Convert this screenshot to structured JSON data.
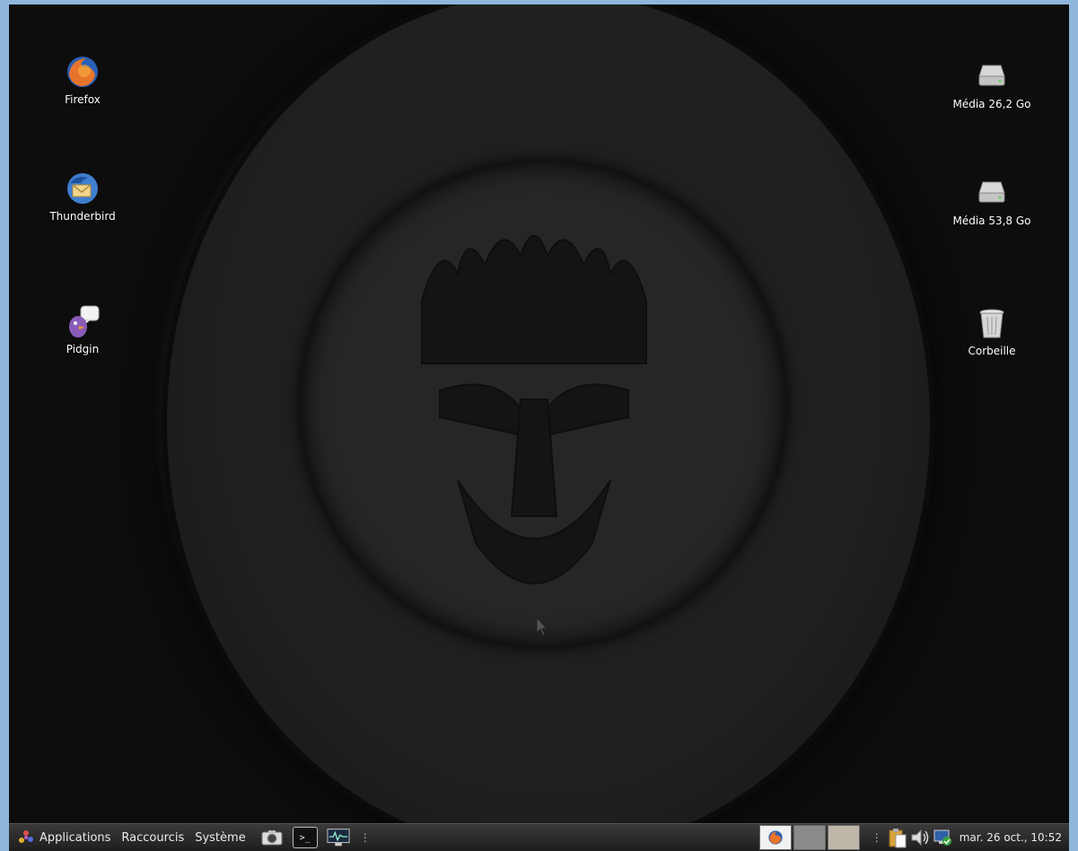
{
  "desktop": {
    "left_icons": [
      {
        "label": "Firefox",
        "icon": "firefox-icon"
      },
      {
        "label": "Thunderbird",
        "icon": "thunderbird-icon"
      },
      {
        "label": "Pidgin",
        "icon": "pidgin-icon"
      }
    ],
    "right_icons": [
      {
        "label": "Média 26,2 Go",
        "icon": "drive-icon"
      },
      {
        "label": "Média 53,8 Go",
        "icon": "drive-icon"
      },
      {
        "label": "Corbeille",
        "icon": "trash-icon"
      }
    ]
  },
  "panel": {
    "menus": [
      "Applications",
      "Raccourcis",
      "Système"
    ],
    "launchers": [
      "camera-icon",
      "terminal-icon",
      "system-monitor-icon"
    ],
    "terminal_glyph": ">_",
    "clock": "mar. 26 oct., 10:52"
  },
  "colors": {
    "border": "#8fb6db",
    "panel_bg": "#2a2a2a",
    "firefox_orange": "#e8742b",
    "thunderbird_blue": "#3f7fd0"
  }
}
